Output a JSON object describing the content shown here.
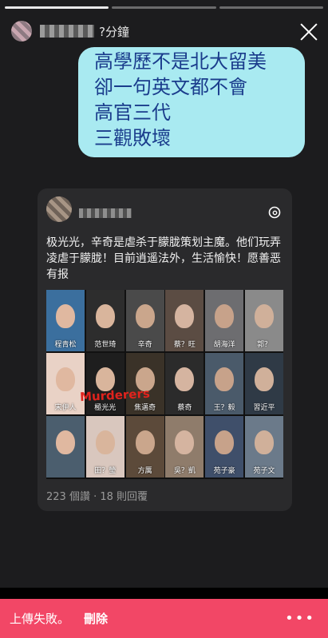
{
  "story": {
    "progress_total": 3,
    "progress_done": 1,
    "time_label": "?分鐘",
    "close_icon": "close-icon"
  },
  "bubble": {
    "lines": [
      "高學歷不是北大留美",
      "卻一句英文都不會",
      "高官三代",
      "三觀敗壞"
    ],
    "color": "#a9eaf1",
    "text_color": "#1a3c8c"
  },
  "card": {
    "text": "极光光，辛奇是虐杀于朦胧策划主魔。他们玩弄凌虐于朦胧！目前逍遥法外，生活愉快！愿善恶有报",
    "logo_icon": "threads-icon",
    "watermark": "Murderers",
    "captions": [
      "程青松",
      "范世琦",
      "辛奇",
      "蔡？旺",
      "胡海洋",
      "郭？",
      "宋伊人",
      "極光光",
      "焦邁奇",
      "蔡奇",
      "王？毅",
      "習近平",
      "",
      "田？瑩",
      "方厲",
      "吳？凱",
      "苑子豪",
      "苑子文"
    ],
    "stats": "223 個讚 · 18 則回覆"
  },
  "footer": {
    "fail_label": "上傳失敗。",
    "delete_label": "刪除",
    "more_icon": "•••",
    "color": "#f24766"
  }
}
